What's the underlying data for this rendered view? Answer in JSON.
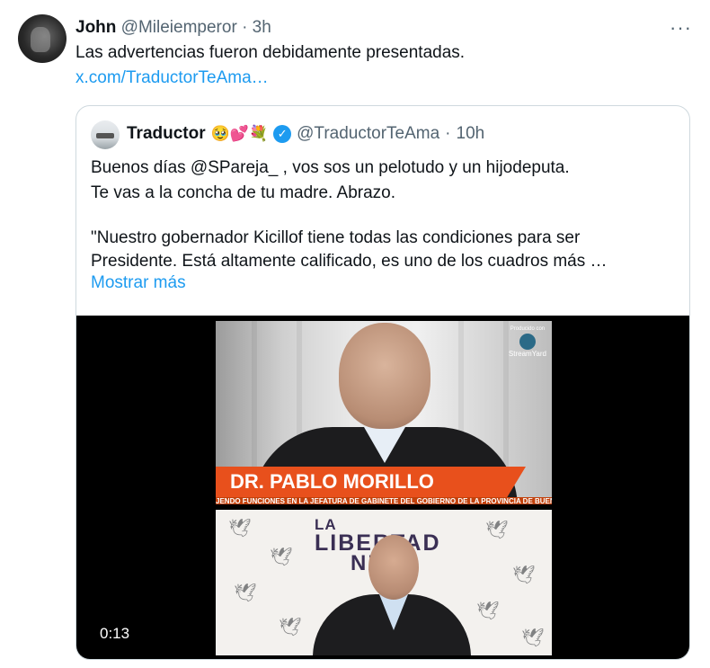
{
  "tweet": {
    "author_name": "John",
    "author_handle": "@Mileiemperor",
    "separator": "·",
    "time": "3h",
    "more": "···",
    "text": "Las advertencias fueron debidamente presentadas.",
    "link": "x.com/TraductorTeAma…"
  },
  "quote": {
    "author_name": "Traductor",
    "emojis": "🥹💕💐",
    "verified_icon": "✓",
    "author_handle": "@TraductorTeAma",
    "separator": "·",
    "time": "10h",
    "lines": [
      "Buenos días @SPareja_ , vos sos un pelotudo y un hijodeputa.",
      "Te vas a la concha de tu madre. Abrazo.",
      "\"Nuestro gobernador Kicillof tiene todas las condiciones para ser",
      "Presidente. Está altamente calificado, es uno de los cuadros más …"
    ],
    "show_more": "Mostrar más"
  },
  "video": {
    "banner_name": "DR. PABLO MORILLO",
    "ticker": "JENDO FUNCIONES EN LA JEFATURA DE GABINETE DEL GOBIERNO DE LA PROVINCIA DE BUEN",
    "streamyard_small": "Producido con",
    "streamyard_name": "StreamYard",
    "logo_la": "LA",
    "logo_big": "LIBERTAD",
    "logo_end": "NZA",
    "duration": "0:13"
  },
  "colors": {
    "link": "#1d9bf0",
    "muted": "#536471",
    "banner": "#e8501c",
    "border": "#cfd9de"
  }
}
